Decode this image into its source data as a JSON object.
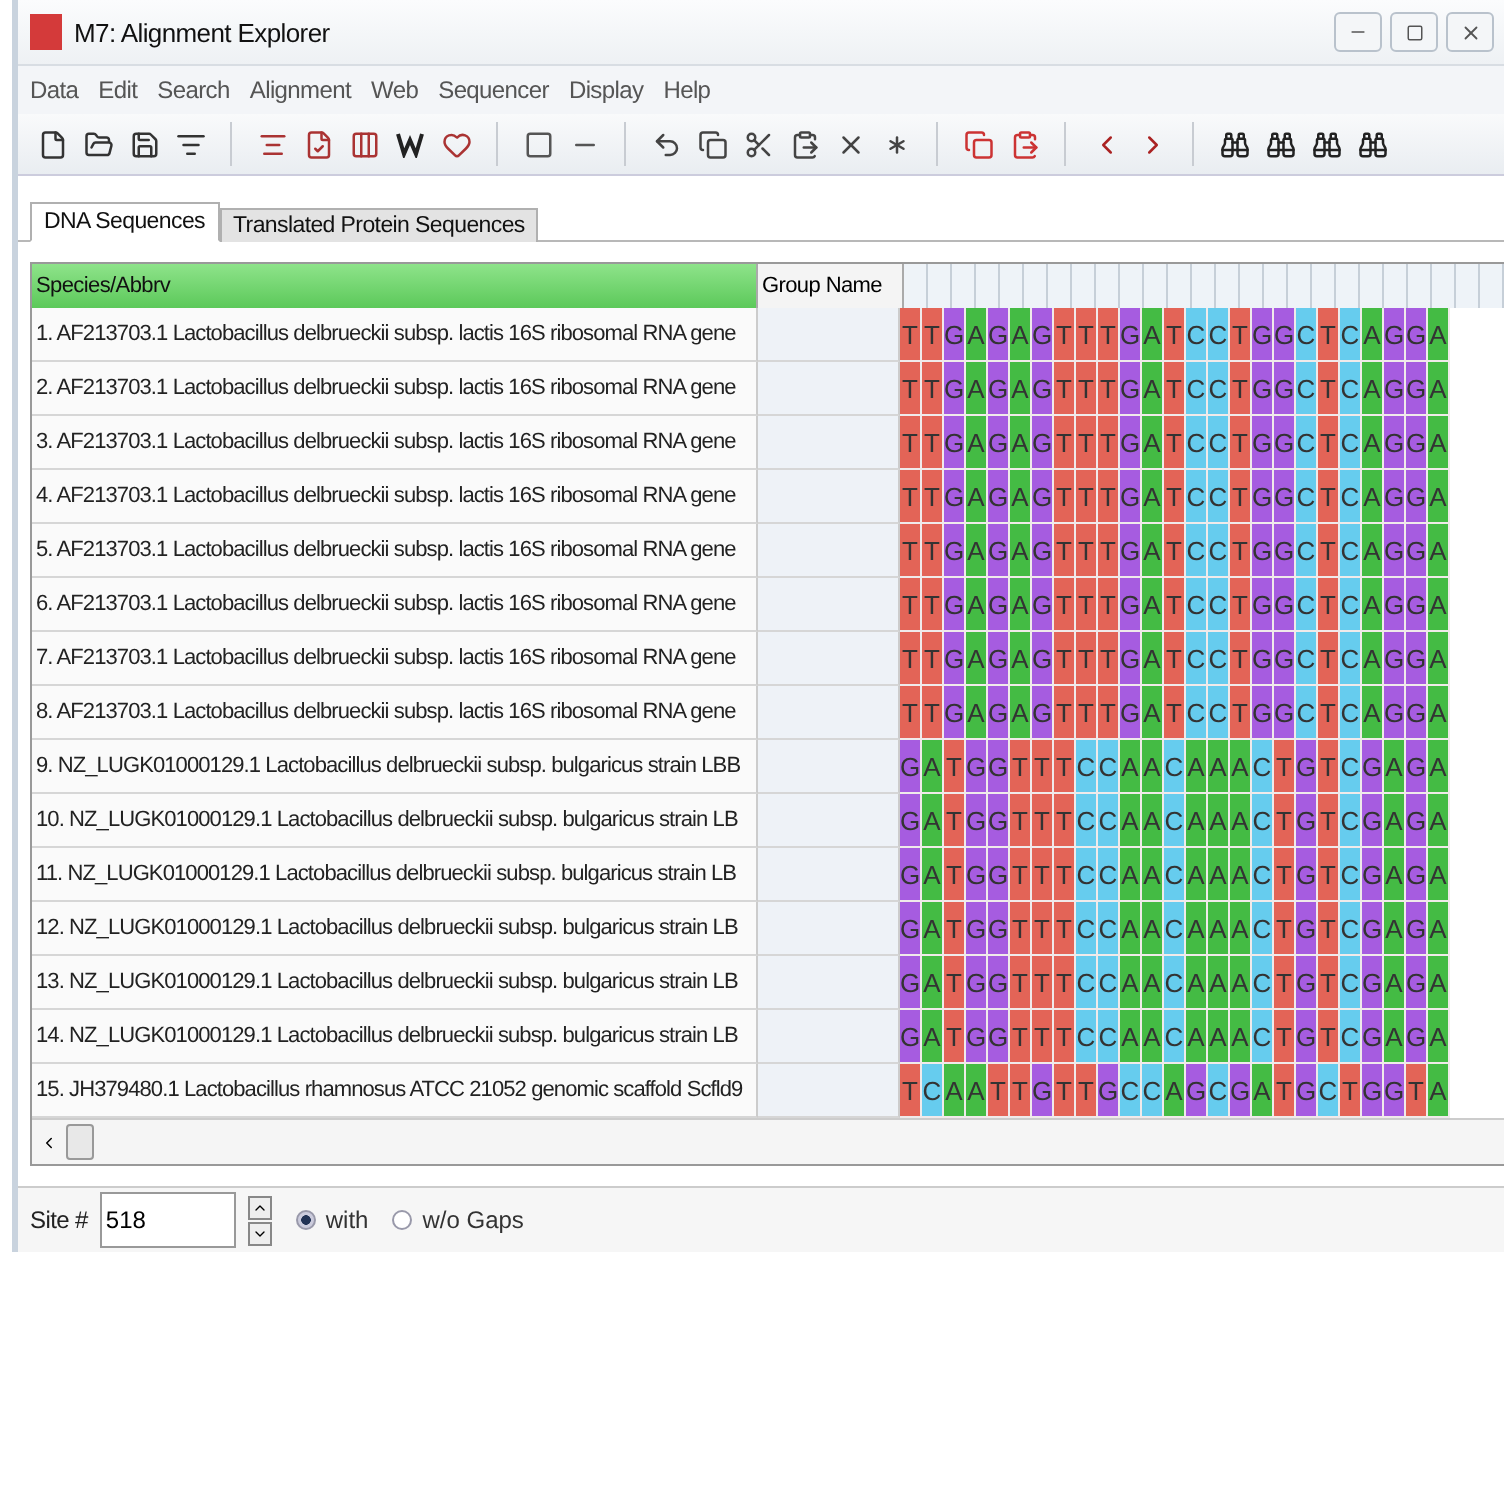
{
  "window": {
    "title": "M7: Alignment Explorer"
  },
  "menu": [
    "Data",
    "Edit",
    "Search",
    "Alignment",
    "Web",
    "Sequencer",
    "Display",
    "Help"
  ],
  "tabs": [
    {
      "label": "DNA Sequences",
      "selected": true
    },
    {
      "label": "Translated Protein Sequences",
      "selected": false
    }
  ],
  "table": {
    "columns": [
      "Species/Abbrv",
      "Group Name"
    ],
    "rows": [
      {
        "name": "1. AF213703.1 Lactobacillus delbrueckii subsp. lactis 16S ribosomal RNA gene",
        "sequence": "TTGAGAGTTTGATCCTGGCTCAGGA"
      },
      {
        "name": "2. AF213703.1 Lactobacillus delbrueckii subsp. lactis 16S ribosomal RNA gene",
        "sequence": "TTGAGAGTTTGATCCTGGCTCAGGA"
      },
      {
        "name": "3. AF213703.1 Lactobacillus delbrueckii subsp. lactis 16S ribosomal RNA gene",
        "sequence": "TTGAGAGTTTGATCCTGGCTCAGGA"
      },
      {
        "name": "4. AF213703.1 Lactobacillus delbrueckii subsp. lactis 16S ribosomal RNA gene",
        "sequence": "TTGAGAGTTTGATCCTGGCTCAGGA"
      },
      {
        "name": "5. AF213703.1 Lactobacillus delbrueckii subsp. lactis 16S ribosomal RNA gene",
        "sequence": "TTGAGAGTTTGATCCTGGCTCAGGA"
      },
      {
        "name": "6. AF213703.1 Lactobacillus delbrueckii subsp. lactis 16S ribosomal RNA gene",
        "sequence": "TTGAGAGTTTGATCCTGGCTCAGGA"
      },
      {
        "name": "7. AF213703.1 Lactobacillus delbrueckii subsp. lactis 16S ribosomal RNA gene",
        "sequence": "TTGAGAGTTTGATCCTGGCTCAGGA"
      },
      {
        "name": "8. AF213703.1 Lactobacillus delbrueckii subsp. lactis 16S ribosomal RNA gene",
        "sequence": "TTGAGAGTTTGATCCTGGCTCAGGA"
      },
      {
        "name": "9. NZ_LUGK01000129.1 Lactobacillus delbrueckii subsp. bulgaricus strain LBB",
        "sequence": "GATGGTTTCCAACAAACTGTCGAGA"
      },
      {
        "name": "10. NZ_LUGK01000129.1 Lactobacillus delbrueckii subsp. bulgaricus strain LB",
        "sequence": "GATGGTTTCCAACAAACTGTCGAGA"
      },
      {
        "name": "11. NZ_LUGK01000129.1 Lactobacillus delbrueckii subsp. bulgaricus strain LB",
        "sequence": "GATGGTTTCCAACAAACTGTCGAGA"
      },
      {
        "name": "12. NZ_LUGK01000129.1 Lactobacillus delbrueckii subsp. bulgaricus strain LB",
        "sequence": "GATGGTTTCCAACAAACTGTCGAGA"
      },
      {
        "name": "13. NZ_LUGK01000129.1 Lactobacillus delbrueckii subsp. bulgaricus strain LB",
        "sequence": "GATGGTTTCCAACAAACTGTCGAGA"
      },
      {
        "name": "14. NZ_LUGK01000129.1 Lactobacillus delbrueckii subsp. bulgaricus strain LB",
        "sequence": "GATGGTTTCCAACAAACTGTCGAGA"
      },
      {
        "name": "15. JH379480.1 Lactobacillus rhamnosus ATCC 21052 genomic scaffold Scfld9",
        "sequence": "TCAATTGTTGCCAGCGATGCTGGTA"
      }
    ]
  },
  "status_bar": {
    "site_label": "Site #",
    "site_value": "518",
    "gap_options": [
      {
        "label": "with",
        "selected": true
      },
      {
        "label": "w/o Gaps",
        "selected": false
      }
    ]
  }
}
